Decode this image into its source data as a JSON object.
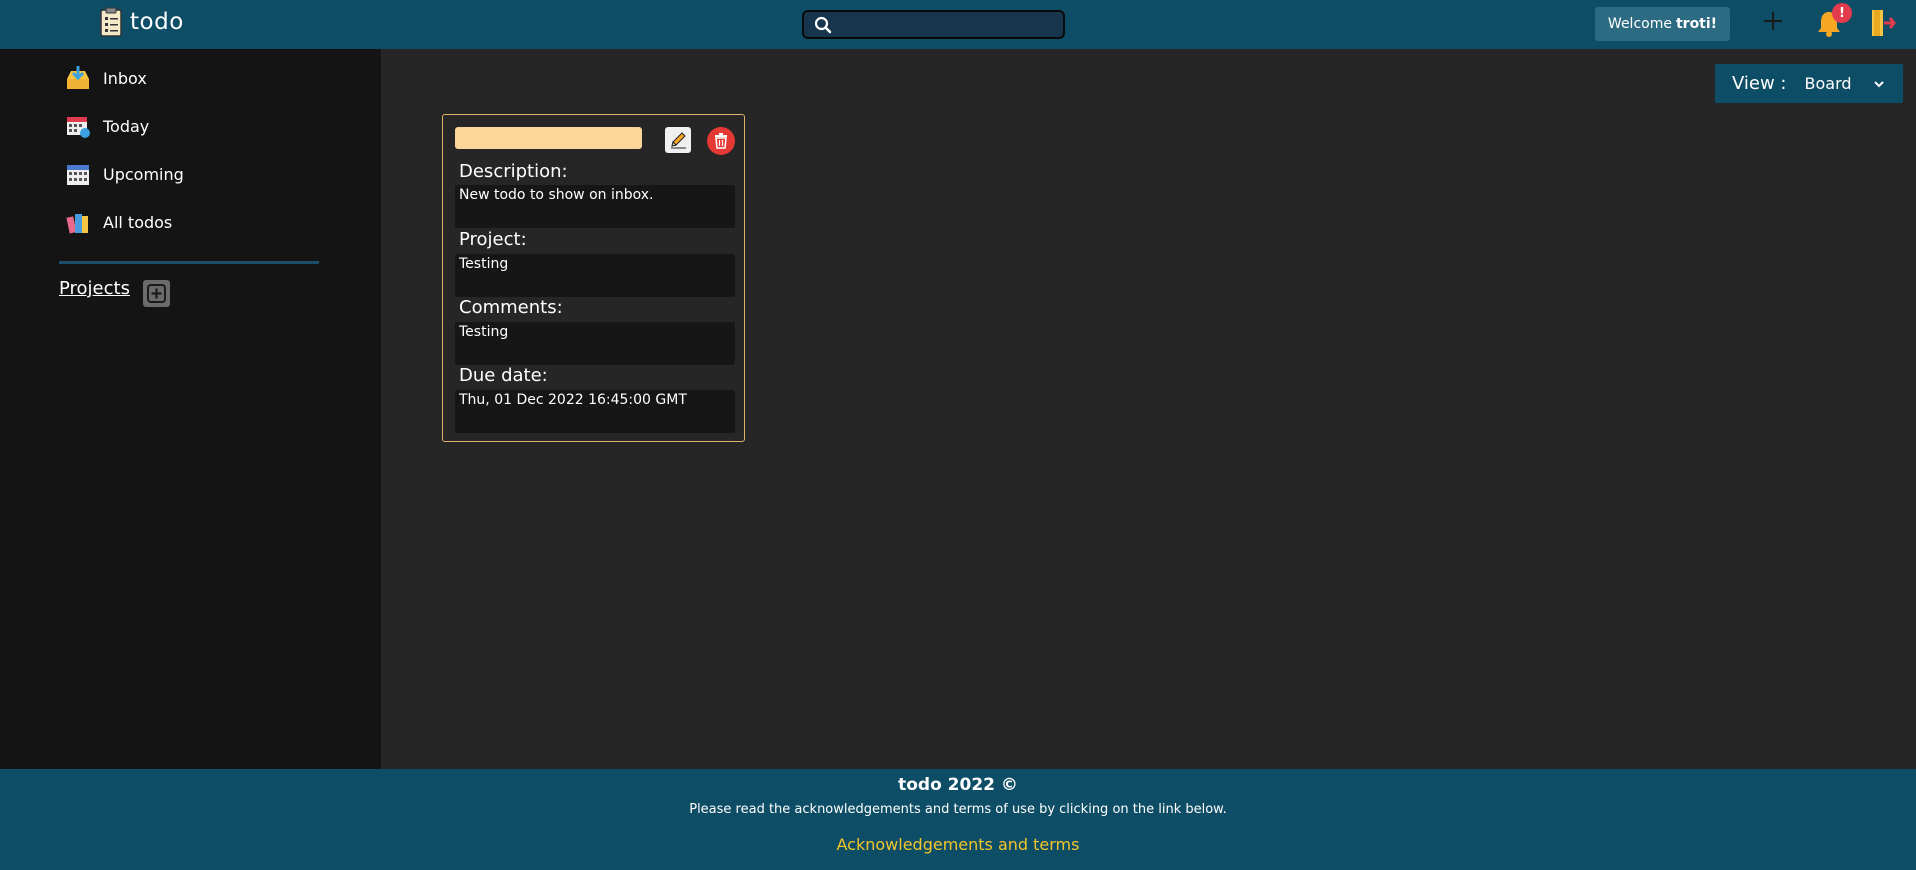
{
  "header": {
    "app_name": "todo",
    "logo_icon": "clipboard-icon",
    "search": {
      "value": "",
      "placeholder": "",
      "icon": "search-icon"
    },
    "welcome_prefix": "Welcome",
    "welcome_user": "troti!",
    "add_icon": "plus-icon",
    "notifications": {
      "icon": "bell-icon",
      "badge": "!"
    },
    "logout_icon": "logout-icon"
  },
  "sidebar": {
    "items": [
      {
        "label": "Inbox",
        "icon": "inbox-icon"
      },
      {
        "label": "Today",
        "icon": "calendar-today-icon"
      },
      {
        "label": "Upcoming",
        "icon": "calendar-upcoming-icon"
      },
      {
        "label": "All todos",
        "icon": "books-icon"
      }
    ],
    "projects_label": "Projects",
    "projects_add_icon": "plus-square-icon"
  },
  "main": {
    "view": {
      "label": "View :",
      "selected": "Board",
      "icon": "chevron-down-icon"
    },
    "todo": {
      "title": "",
      "description_label": "Description:",
      "description": "New todo to show on inbox.",
      "project_label": "Project:",
      "project": "Testing",
      "comments_label": "Comments:",
      "comments": "Testing",
      "due_label": "Due date:",
      "due": "Thu, 01 Dec 2022 16:45:00 GMT",
      "edit_icon": "pencil-icon",
      "delete_icon": "trash-icon"
    }
  },
  "footer": {
    "title": "todo 2022 ©",
    "text": "Please read the acknowledgements and terms of use by clicking on the link below.",
    "link": "Acknowledgements and terms"
  },
  "colors": {
    "header_bg": "#0e4d66",
    "sidebar_bg": "#141414",
    "main_bg": "#262626",
    "card_border": "#e0b36a",
    "title_bar": "#fcd699",
    "delete_red": "#e53935",
    "badge_red": "#e23b4e",
    "link_yellow": "#f2c62a"
  }
}
